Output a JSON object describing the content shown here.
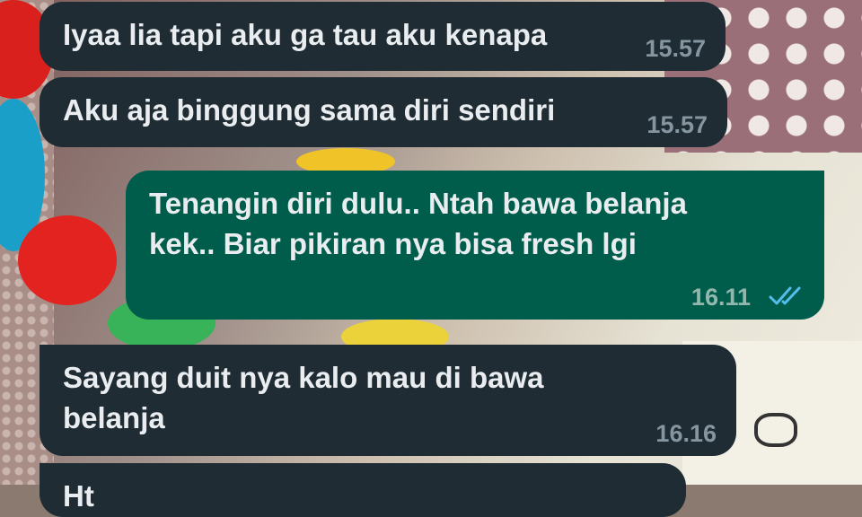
{
  "messages": [
    {
      "direction": "incoming",
      "text": "Iyaa lia tapi aku ga tau aku kenapa",
      "time": "15.57"
    },
    {
      "direction": "incoming",
      "text": "Aku aja binggung sama diri sendiri",
      "time": "15.57"
    },
    {
      "direction": "outgoing",
      "text": "Tenangin diri dulu.. Ntah bawa belanja kek.. Biar pikiran nya bisa fresh lgi",
      "time": "16.11",
      "status_icon": "double-check-read-icon"
    },
    {
      "direction": "incoming",
      "text": "Sayang duit nya kalo mau di bawa belanja",
      "time": "16.16"
    },
    {
      "direction": "incoming",
      "text": "Ht",
      "time": ""
    }
  ],
  "colors": {
    "incoming_bubble": "#1f2c34",
    "outgoing_bubble": "#005c4b",
    "read_tick": "#53bdeb",
    "message_text": "#e9edef",
    "timestamp": "#8696a0"
  }
}
